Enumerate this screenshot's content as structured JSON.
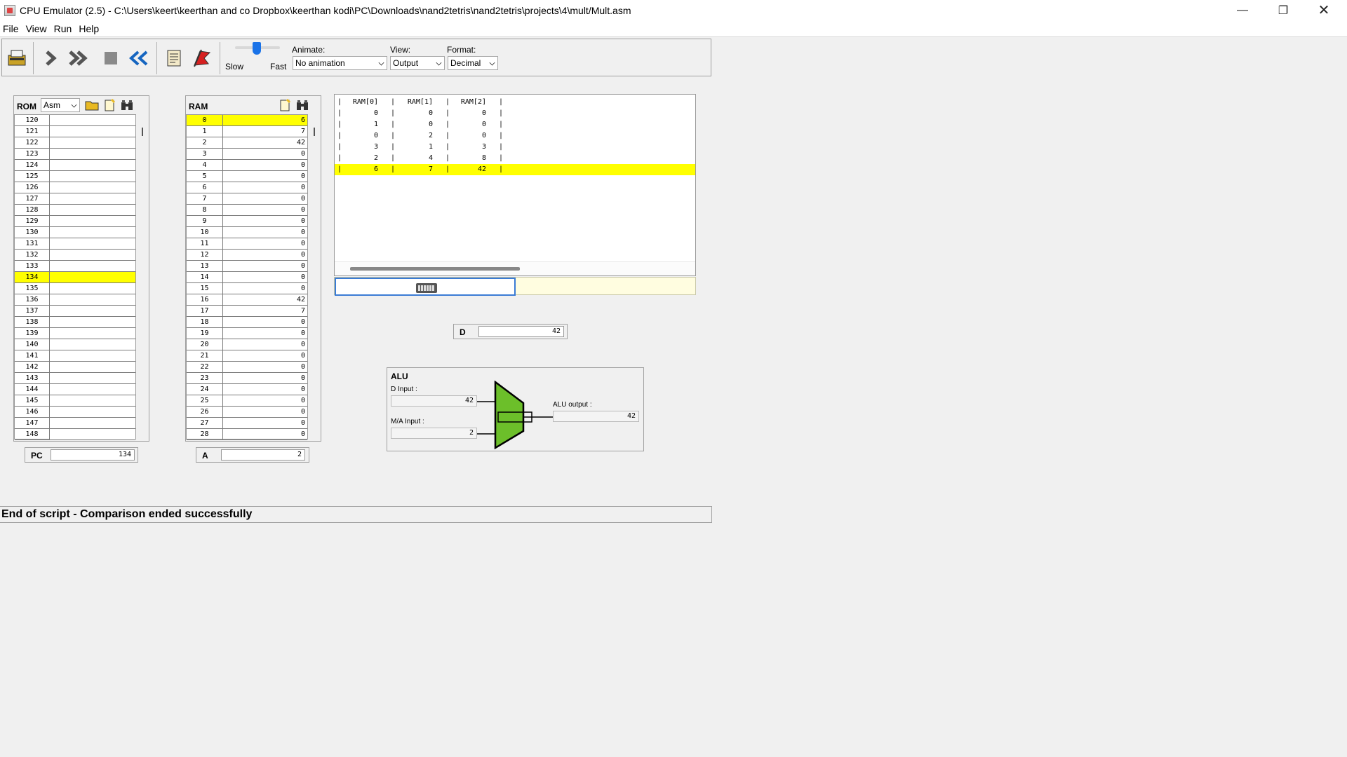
{
  "window": {
    "title": "CPU Emulator (2.5) - C:\\Users\\keert\\keerthan and co Dropbox\\keerthan kodi\\PC\\Downloads\\nand2tetris\\nand2tetris\\projects\\4\\mult/Mult.asm",
    "minimize": "—",
    "maximize": "❐",
    "close": "✕"
  },
  "menu": [
    "File",
    "View",
    "Run",
    "Help"
  ],
  "toolbar": {
    "slow_label": "Slow",
    "fast_label": "Fast",
    "animate_label": "Animate:",
    "animate_value": "No animation",
    "view_label": "View:",
    "view_value": "Output",
    "format_label": "Format:",
    "format_value": "Decimal"
  },
  "rom": {
    "label": "ROM",
    "mode": "Asm",
    "rows": [
      {
        "addr": "120",
        "val": ""
      },
      {
        "addr": "121",
        "val": ""
      },
      {
        "addr": "122",
        "val": ""
      },
      {
        "addr": "123",
        "val": ""
      },
      {
        "addr": "124",
        "val": ""
      },
      {
        "addr": "125",
        "val": ""
      },
      {
        "addr": "126",
        "val": ""
      },
      {
        "addr": "127",
        "val": ""
      },
      {
        "addr": "128",
        "val": ""
      },
      {
        "addr": "129",
        "val": ""
      },
      {
        "addr": "130",
        "val": ""
      },
      {
        "addr": "131",
        "val": ""
      },
      {
        "addr": "132",
        "val": ""
      },
      {
        "addr": "133",
        "val": ""
      },
      {
        "addr": "134",
        "val": ""
      },
      {
        "addr": "135",
        "val": ""
      },
      {
        "addr": "136",
        "val": ""
      },
      {
        "addr": "137",
        "val": ""
      },
      {
        "addr": "138",
        "val": ""
      },
      {
        "addr": "139",
        "val": ""
      },
      {
        "addr": "140",
        "val": ""
      },
      {
        "addr": "141",
        "val": ""
      },
      {
        "addr": "142",
        "val": ""
      },
      {
        "addr": "143",
        "val": ""
      },
      {
        "addr": "144",
        "val": ""
      },
      {
        "addr": "145",
        "val": ""
      },
      {
        "addr": "146",
        "val": ""
      },
      {
        "addr": "147",
        "val": ""
      },
      {
        "addr": "148",
        "val": ""
      }
    ],
    "highlight_addr": "134"
  },
  "ram": {
    "label": "RAM",
    "rows": [
      {
        "addr": "0",
        "val": "6"
      },
      {
        "addr": "1",
        "val": "7"
      },
      {
        "addr": "2",
        "val": "42"
      },
      {
        "addr": "3",
        "val": "0"
      },
      {
        "addr": "4",
        "val": "0"
      },
      {
        "addr": "5",
        "val": "0"
      },
      {
        "addr": "6",
        "val": "0"
      },
      {
        "addr": "7",
        "val": "0"
      },
      {
        "addr": "8",
        "val": "0"
      },
      {
        "addr": "9",
        "val": "0"
      },
      {
        "addr": "10",
        "val": "0"
      },
      {
        "addr": "11",
        "val": "0"
      },
      {
        "addr": "12",
        "val": "0"
      },
      {
        "addr": "13",
        "val": "0"
      },
      {
        "addr": "14",
        "val": "0"
      },
      {
        "addr": "15",
        "val": "0"
      },
      {
        "addr": "16",
        "val": "42"
      },
      {
        "addr": "17",
        "val": "7"
      },
      {
        "addr": "18",
        "val": "0"
      },
      {
        "addr": "19",
        "val": "0"
      },
      {
        "addr": "20",
        "val": "0"
      },
      {
        "addr": "21",
        "val": "0"
      },
      {
        "addr": "22",
        "val": "0"
      },
      {
        "addr": "23",
        "val": "0"
      },
      {
        "addr": "24",
        "val": "0"
      },
      {
        "addr": "25",
        "val": "0"
      },
      {
        "addr": "26",
        "val": "0"
      },
      {
        "addr": "27",
        "val": "0"
      },
      {
        "addr": "28",
        "val": "0"
      }
    ],
    "highlight_addr": "0"
  },
  "registers": {
    "pc_label": "PC",
    "pc_value": "134",
    "a_label": "A",
    "a_value": "2",
    "d_label": "D",
    "d_value": "42"
  },
  "output": {
    "headers": [
      "RAM[0]",
      "RAM[1]",
      "RAM[2]"
    ],
    "rows": [
      [
        "0",
        "0",
        "0"
      ],
      [
        "1",
        "0",
        "0"
      ],
      [
        "0",
        "2",
        "0"
      ],
      [
        "3",
        "1",
        "3"
      ],
      [
        "2",
        "4",
        "8"
      ],
      [
        "6",
        "7",
        "42"
      ]
    ],
    "highlight_row": 5
  },
  "alu": {
    "title": "ALU",
    "d_input_label": "D Input :",
    "d_input_value": "42",
    "ma_input_label": "M/A Input :",
    "ma_input_value": "2",
    "output_label": "ALU output :",
    "output_value": "42",
    "color": "#6cbf2a"
  },
  "status": "End of script - Comparison ended successfully",
  "colors": {
    "highlight": "#ffff00",
    "accent": "#1a73e8"
  }
}
